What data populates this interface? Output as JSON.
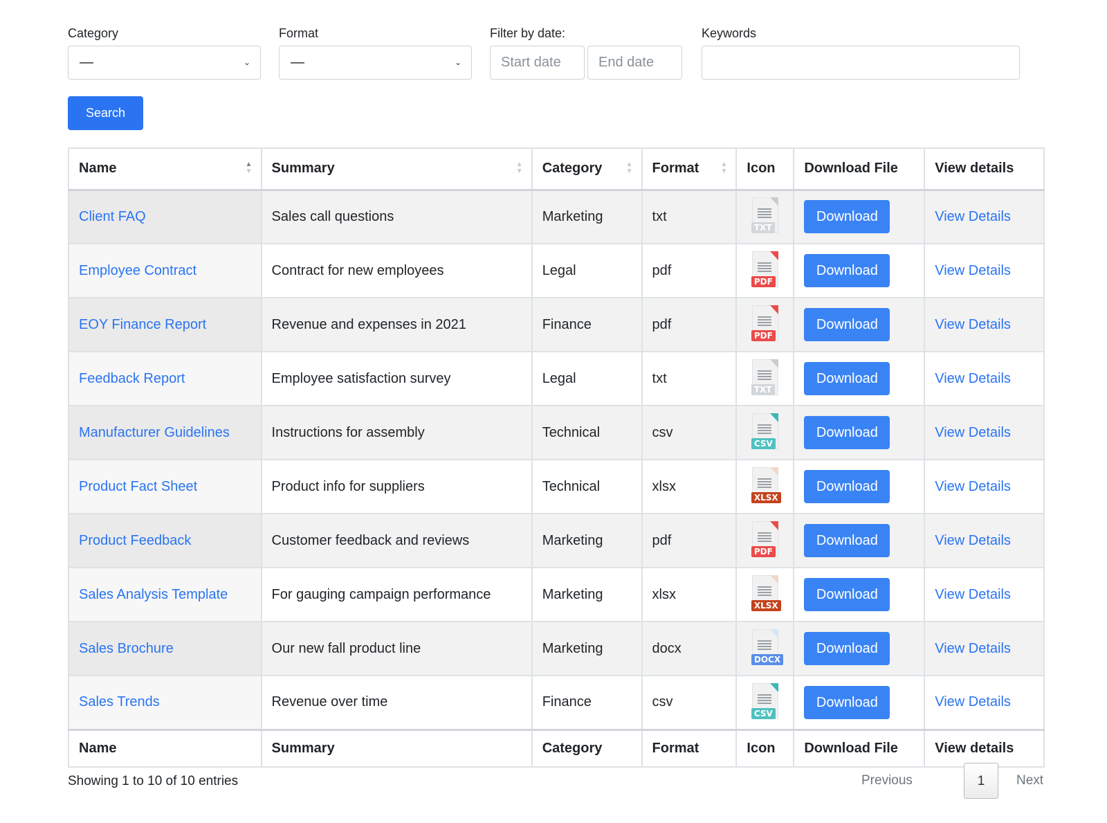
{
  "filters": {
    "category": {
      "label": "Category",
      "value": "—"
    },
    "format": {
      "label": "Format",
      "value": "—"
    },
    "date": {
      "label": "Filter by date:",
      "start_placeholder": "Start date",
      "end_placeholder": "End date"
    },
    "keywords": {
      "label": "Keywords",
      "value": ""
    },
    "search_label": "Search"
  },
  "table": {
    "headers": [
      "Name",
      "Summary",
      "Category",
      "Format",
      "Icon",
      "Download File",
      "View details"
    ],
    "rows": [
      {
        "name": "Client FAQ",
        "summary": "Sales call questions",
        "category": "Marketing",
        "format": "txt",
        "icon": "txt-file-icon",
        "download": "Download",
        "details": "View Details"
      },
      {
        "name": "Employee Contract",
        "summary": "Contract for new employees",
        "category": "Legal",
        "format": "pdf",
        "icon": "pdf-file-icon",
        "download": "Download",
        "details": "View Details"
      },
      {
        "name": "EOY Finance Report",
        "summary": "Revenue and expenses in 2021",
        "category": "Finance",
        "format": "pdf",
        "icon": "pdf-file-icon",
        "download": "Download",
        "details": "View Details"
      },
      {
        "name": "Feedback Report",
        "summary": "Employee satisfaction survey",
        "category": "Legal",
        "format": "txt",
        "icon": "txt-file-icon",
        "download": "Download",
        "details": "View Details"
      },
      {
        "name": "Manufacturer Guidelines",
        "summary": "Instructions for assembly",
        "category": "Technical",
        "format": "csv",
        "icon": "csv-file-icon",
        "download": "Download",
        "details": "View Details"
      },
      {
        "name": "Product Fact Sheet",
        "summary": "Product info for suppliers",
        "category": "Technical",
        "format": "xlsx",
        "icon": "xlsx-file-icon",
        "download": "Download",
        "details": "View Details"
      },
      {
        "name": "Product Feedback",
        "summary": "Customer feedback and reviews",
        "category": "Marketing",
        "format": "pdf",
        "icon": "pdf-file-icon",
        "download": "Download",
        "details": "View Details"
      },
      {
        "name": "Sales Analysis Template",
        "summary": "For gauging campaign performance",
        "category": "Marketing",
        "format": "xlsx",
        "icon": "xlsx-file-icon",
        "download": "Download",
        "details": "View Details"
      },
      {
        "name": "Sales Brochure",
        "summary": "Our new fall product line",
        "category": "Marketing",
        "format": "docx",
        "icon": "docx-file-icon",
        "download": "Download",
        "details": "View Details"
      },
      {
        "name": "Sales Trends",
        "summary": "Revenue over time",
        "category": "Finance",
        "format": "csv",
        "icon": "csv-file-icon",
        "download": "Download",
        "details": "View Details"
      }
    ]
  },
  "icon_styles": {
    "txt": {
      "tag": "TXT",
      "color": "#d3d6d9",
      "fold": "#c9cdd1"
    },
    "pdf": {
      "tag": "PDF",
      "color": "#ec4b4b",
      "fold": "#ec4b4b"
    },
    "csv": {
      "tag": "CSV",
      "color": "#4fc1c0",
      "fold": "#3bb8b7"
    },
    "xlsx": {
      "tag": "XLSX",
      "color": "#c4431c",
      "fold": "#f2d6c9"
    },
    "docx": {
      "tag": "DOCX",
      "color": "#5a8ee8",
      "fold": "#d7e3f7"
    }
  },
  "footer": {
    "info": "Showing 1 to 10 of 10 entries",
    "previous": "Previous",
    "current_page": "1",
    "next": "Next"
  },
  "colors": {
    "primary": "#2a74f1",
    "link": "#2a74f1",
    "border": "#dee2e6",
    "stripe": "#f2f2f2"
  }
}
